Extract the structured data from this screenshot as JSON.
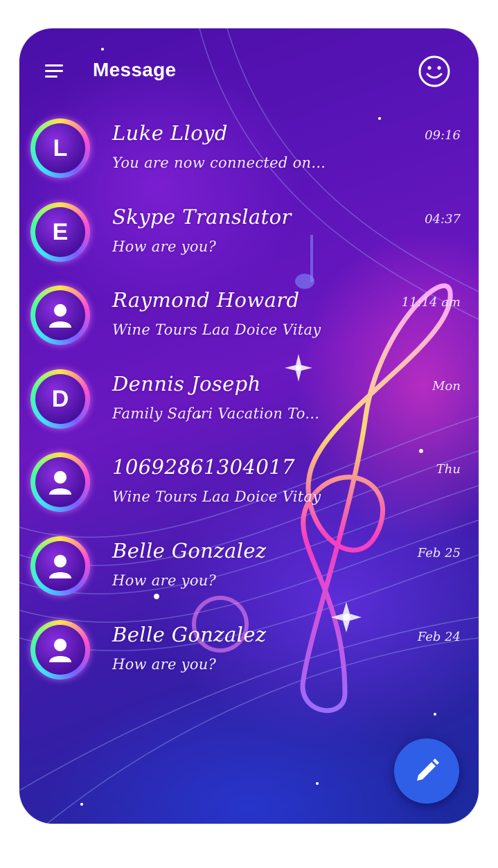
{
  "header": {
    "title": "Message",
    "menu_icon": "hamburger-menu-icon",
    "emoji_icon": "smiley-face-icon"
  },
  "conversations": [
    {
      "name": "Luke Lloyd",
      "preview": "You are now connected on...",
      "time": "09:16",
      "avatar_letter": "L"
    },
    {
      "name": "Skype Translator",
      "preview": "How are you?",
      "time": "04:37",
      "avatar_letter": "E"
    },
    {
      "name": "Raymond Howard",
      "preview": "Wine Tours Laa Doice Vitay",
      "time": "11:14 am",
      "avatar_letter": ""
    },
    {
      "name": "Dennis Joseph",
      "preview": "Family Safari Vacation To...",
      "time": "Mon",
      "avatar_letter": "D"
    },
    {
      "name": "10692861304017",
      "preview": "Wine Tours Laa Doice Vitay",
      "time": "Thu",
      "avatar_letter": ""
    },
    {
      "name": "Belle Gonzalez",
      "preview": "How are you?",
      "time": "Feb 25",
      "avatar_letter": ""
    },
    {
      "name": "Belle Gonzalez",
      "preview": "How are you?",
      "time": "Feb 24",
      "avatar_letter": ""
    }
  ],
  "fab": {
    "icon": "pencil-compose-icon"
  },
  "colors": {
    "accent": "#2f5fe6",
    "background_top": "#4a0fa8",
    "background_bottom": "#1a2a9e",
    "text": "#ffffff"
  }
}
